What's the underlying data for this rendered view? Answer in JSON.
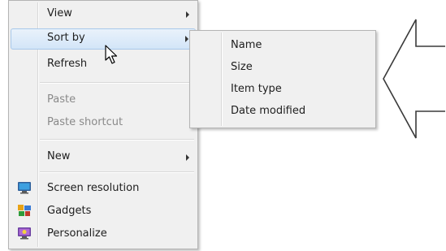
{
  "context_menu": {
    "items": [
      {
        "label": "View",
        "submenu": true
      },
      {
        "label": "Sort by",
        "submenu": true,
        "highlighted": true
      },
      {
        "label": "Refresh"
      },
      {
        "label": "Paste",
        "disabled": true
      },
      {
        "label": "Paste shortcut",
        "disabled": true
      },
      {
        "label": "New",
        "submenu": true
      },
      {
        "label": "Screen resolution",
        "icon": "screen-resolution-icon"
      },
      {
        "label": "Gadgets",
        "icon": "gadgets-icon"
      },
      {
        "label": "Personalize",
        "icon": "personalize-icon"
      }
    ]
  },
  "sort_submenu": {
    "items": [
      {
        "label": "Name"
      },
      {
        "label": "Size"
      },
      {
        "label": "Item type"
      },
      {
        "label": "Date modified"
      }
    ]
  },
  "colors": {
    "menu_background": "#f0f0f0",
    "highlight": "#d3e5f8",
    "highlight_border": "#a8c8ea",
    "disabled_text": "#8a8a8a"
  }
}
